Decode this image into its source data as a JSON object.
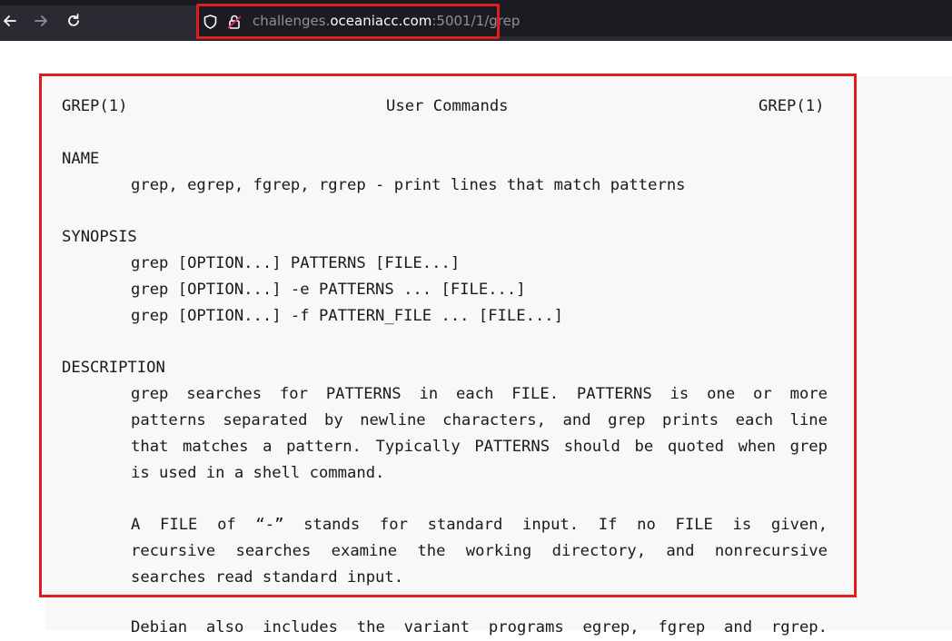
{
  "browser": {
    "url_prefix": "challenges.",
    "url_domain": "oceaniacc.com",
    "url_suffix": ":5001/1/grep"
  },
  "man": {
    "header_left": "GREP(1)",
    "header_center": "User Commands",
    "header_right": "GREP(1)",
    "name_heading": "NAME",
    "name_text": "grep, egrep, fgrep, rgrep - print lines that match patterns",
    "synopsis_heading": "SYNOPSIS",
    "synopsis_lines": [
      "grep [OPTION...] PATTERNS [FILE...]",
      "grep [OPTION...] -e PATTERNS ... [FILE...]",
      "grep [OPTION...] -f PATTERN_FILE ... [FILE...]"
    ],
    "description_heading": "DESCRIPTION",
    "desc_p1": [
      "grep searches for PATTERNS in each FILE. PATTERNS is one or more",
      "patterns separated by newline characters, and grep prints each line",
      "that matches a pattern. Typically PATTERNS should be quoted when grep",
      "is used in a shell command."
    ],
    "desc_p2": [
      "A FILE of “-” stands for standard input. If no FILE is given,",
      "recursive searches examine the working directory, and nonrecursive",
      "searches read standard input."
    ],
    "desc_p3_partial": "Debian also includes the variant programs egrep, fgrep and rgrep."
  }
}
